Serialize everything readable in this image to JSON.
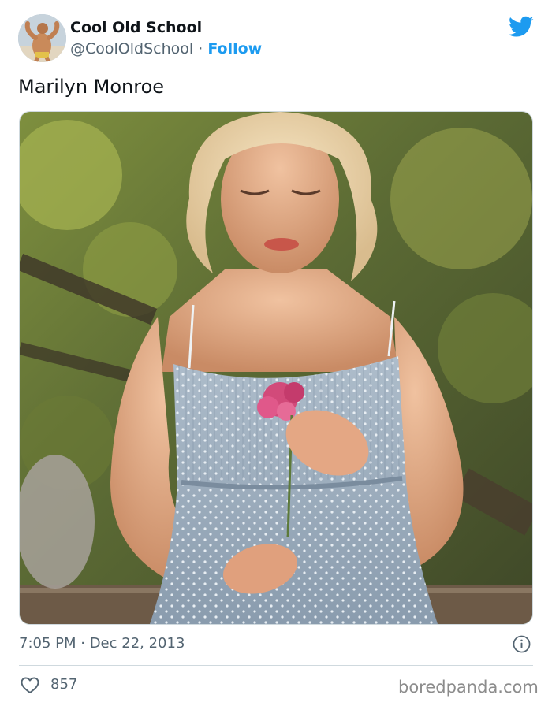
{
  "tweet": {
    "author": {
      "display_name": "Cool Old School",
      "handle": "@CoolOldSchool",
      "separator": "·",
      "follow_label": "Follow"
    },
    "text": "Marilyn Monroe",
    "timestamp": "7:05 PM · Dec 22, 2013",
    "likes": "857"
  },
  "watermark": "boredpanda.com",
  "icons": {
    "brand": "twitter-bird-icon",
    "info": "info-icon",
    "like": "heart-icon"
  },
  "colors": {
    "accent": "#1d9bf0",
    "text_primary": "#0f1419",
    "text_secondary": "#536471",
    "divider": "#cfd9de",
    "watermark": "#8c8c8c"
  }
}
